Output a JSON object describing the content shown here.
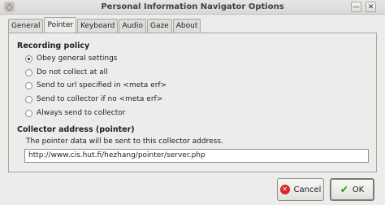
{
  "window": {
    "title": "Personal Information Navigator Options",
    "minimize_glyph": "—",
    "close_glyph": "✕"
  },
  "tabs": [
    {
      "label": "General",
      "active": false
    },
    {
      "label": "Pointer",
      "active": true
    },
    {
      "label": "Keyboard",
      "active": false
    },
    {
      "label": "Audio",
      "active": false
    },
    {
      "label": "Gaze",
      "active": false
    },
    {
      "label": "About",
      "active": false
    }
  ],
  "recording": {
    "heading": "Recording policy",
    "options": [
      {
        "label": "Obey general settings",
        "checked": true
      },
      {
        "label": "Do not collect at all",
        "checked": false
      },
      {
        "label": "Send to url specified in <meta erf>",
        "checked": false
      },
      {
        "label": "Send to collector if no <meta erf>",
        "checked": false
      },
      {
        "label": "Always send to collector",
        "checked": false
      }
    ]
  },
  "collector": {
    "heading": "Collector address (pointer)",
    "description": "The pointer data will be sent to this collector address.",
    "value": "http://www.cis.hut.fi/hezhang/pointer/server.php"
  },
  "buttons": {
    "cancel": "Cancel",
    "ok": "OK"
  }
}
